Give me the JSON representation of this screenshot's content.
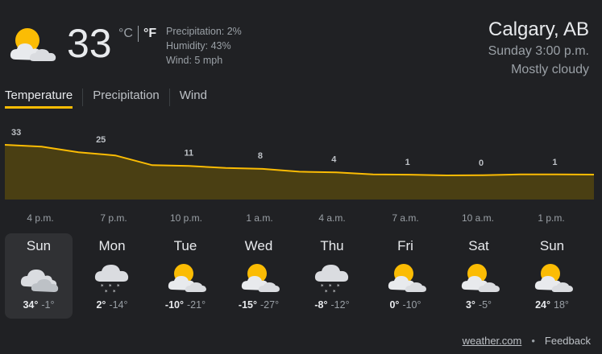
{
  "current": {
    "temp": "33",
    "unit_c": "°C",
    "unit_f": "°F",
    "precipitation": "Precipitation: 2%",
    "humidity": "Humidity: 43%",
    "wind": "Wind: 5 mph",
    "icon": "partly-cloudy-icon"
  },
  "location": {
    "city": "Calgary, AB",
    "time": "Sunday 3:00 p.m.",
    "condition": "Mostly cloudy"
  },
  "tabs": [
    {
      "label": "Temperature",
      "active": true
    },
    {
      "label": "Precipitation",
      "active": false
    },
    {
      "label": "Wind",
      "active": false
    }
  ],
  "chart_data": {
    "type": "area",
    "point_labels": [
      "33",
      "25",
      "11",
      "8",
      "4",
      "1",
      "0",
      "1"
    ],
    "values": [
      33,
      25,
      11,
      8,
      4,
      1,
      0,
      1
    ],
    "times": [
      "4 p.m.",
      "7 p.m.",
      "10 p.m.",
      "1 a.m.",
      "4 a.m.",
      "7 a.m.",
      "10 a.m.",
      "1 p.m."
    ]
  },
  "forecast": [
    {
      "day": "Sun",
      "high": "34°",
      "low": "-1°",
      "icon": "cloudy-icon",
      "selected": true
    },
    {
      "day": "Mon",
      "high": "2°",
      "low": "-14°",
      "icon": "snow-icon",
      "selected": false
    },
    {
      "day": "Tue",
      "high": "-10°",
      "low": "-21°",
      "icon": "partly-cloudy-icon",
      "selected": false
    },
    {
      "day": "Wed",
      "high": "-15°",
      "low": "-27°",
      "icon": "partly-cloudy-icon",
      "selected": false
    },
    {
      "day": "Thu",
      "high": "-8°",
      "low": "-12°",
      "icon": "snow-icon",
      "selected": false
    },
    {
      "day": "Fri",
      "high": "0°",
      "low": "-10°",
      "icon": "partly-cloudy-icon",
      "selected": false
    },
    {
      "day": "Sat",
      "high": "3°",
      "low": "-5°",
      "icon": "partly-cloudy-icon",
      "selected": false
    },
    {
      "day": "Sun",
      "high": "24°",
      "low": "18°",
      "icon": "partly-cloudy-icon",
      "selected": false
    }
  ],
  "footer": {
    "source": "weather.com",
    "separator": "•",
    "feedback": "Feedback"
  },
  "colors": {
    "background": "#202124",
    "accent": "#fbbc04",
    "graph_fill": "#4a3f13",
    "graph_line": "#fbbc04"
  }
}
